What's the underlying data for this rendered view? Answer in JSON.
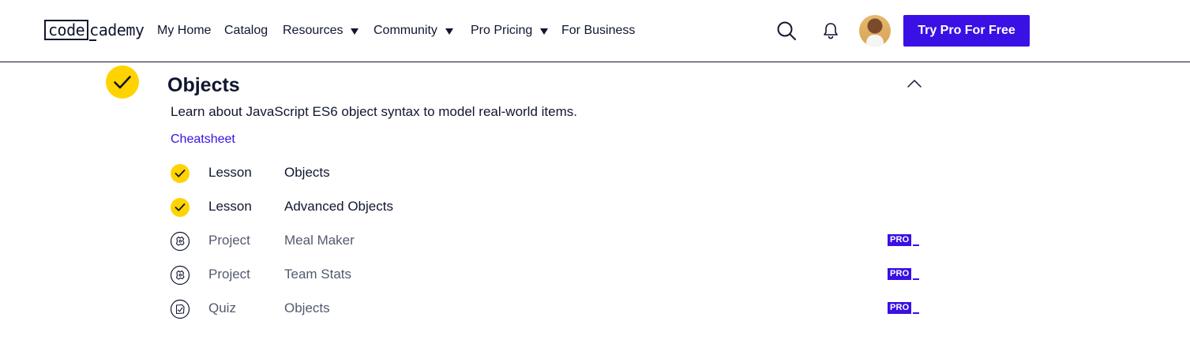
{
  "header": {
    "logo": {
      "box_text": "code",
      "rest_text": "cademy"
    },
    "nav": [
      {
        "label": "My Home",
        "dropdown": false
      },
      {
        "label": "Catalog",
        "dropdown": false
      },
      {
        "label": "Resources",
        "dropdown": true
      },
      {
        "label": "Community",
        "dropdown": true
      },
      {
        "label": "Pro Pricing",
        "dropdown": true
      },
      {
        "label": "For Business",
        "dropdown": false
      }
    ],
    "icons": {
      "search": "search-icon",
      "notifications": "bell-icon",
      "avatar": "user-avatar"
    },
    "cta_label": "Try Pro For Free"
  },
  "module": {
    "title": "Objects",
    "description": "Learn about JavaScript ES6 object syntax to model real-world items.",
    "cheatsheet_label": "Cheatsheet",
    "completed": true,
    "items": [
      {
        "type": "Lesson",
        "name": "Objects",
        "status": "completed",
        "icon": "check-icon",
        "pro": false
      },
      {
        "type": "Lesson",
        "name": "Advanced Objects",
        "status": "completed",
        "icon": "check-icon",
        "pro": false
      },
      {
        "type": "Project",
        "name": "Meal Maker",
        "status": "not-started",
        "icon": "project-icon",
        "pro": true,
        "pro_label": "PRO"
      },
      {
        "type": "Project",
        "name": "Team Stats",
        "status": "not-started",
        "icon": "project-icon",
        "pro": true,
        "pro_label": "PRO"
      },
      {
        "type": "Quiz",
        "name": "Objects",
        "status": "not-started",
        "icon": "quiz-icon",
        "pro": true,
        "pro_label": "PRO"
      }
    ]
  },
  "colors": {
    "accent": "#3a10e5",
    "complete": "#ffd300",
    "text": "#10162f",
    "muted": "#545a6e"
  }
}
